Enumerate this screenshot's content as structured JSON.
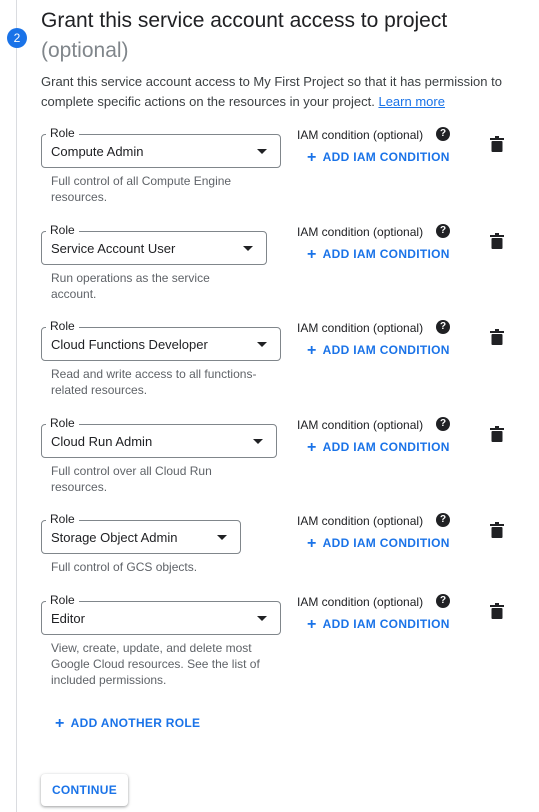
{
  "step": {
    "number": "2",
    "title": "Grant this service account access to project",
    "subtitle": "(optional)",
    "description": "Grant this service account access to My First Project so that it has permission to complete specific actions on the resources in your project.",
    "learn_more": "Learn more"
  },
  "roles": [
    {
      "legend": "Role",
      "value": "Compute Admin",
      "hint": "Full control of all Compute Engine resources.",
      "iam_label": "IAM condition (optional)",
      "add_condition": "ADD IAM CONDITION"
    },
    {
      "legend": "Role",
      "value": "Service Account User",
      "hint": "Run operations as the service account.",
      "iam_label": "IAM condition (optional)",
      "add_condition": "ADD IAM CONDITION"
    },
    {
      "legend": "Role",
      "value": "Cloud Functions Developer",
      "hint": "Read and write access to all functions-related resources.",
      "iam_label": "IAM condition (optional)",
      "add_condition": "ADD IAM CONDITION"
    },
    {
      "legend": "Role",
      "value": "Cloud Run Admin",
      "hint": "Full control over all Cloud Run resources.",
      "iam_label": "IAM condition (optional)",
      "add_condition": "ADD IAM CONDITION"
    },
    {
      "legend": "Role",
      "value": "Storage Object Admin",
      "hint": "Full control of GCS objects.",
      "iam_label": "IAM condition (optional)",
      "add_condition": "ADD IAM CONDITION"
    },
    {
      "legend": "Role",
      "value": "Editor",
      "hint": "View, create, update, and delete most Google Cloud resources. See the list of included permissions.",
      "iam_label": "IAM condition (optional)",
      "add_condition": "ADD IAM CONDITION"
    }
  ],
  "actions": {
    "add_another_role": "ADD ANOTHER ROLE",
    "continue": "CONTINUE"
  },
  "icons": {
    "help": "help-icon",
    "delete": "trash-icon",
    "plus": "plus-icon",
    "dropdown": "arrow-drop-down-icon"
  },
  "colors": {
    "accent": "#1a73e8",
    "text": "#202124",
    "hint": "#5f6368"
  }
}
